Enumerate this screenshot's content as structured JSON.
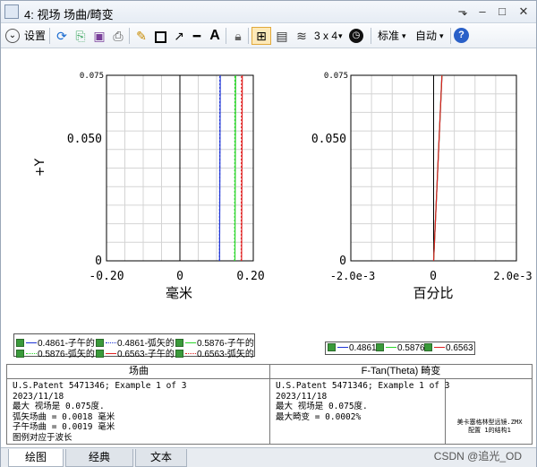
{
  "window": {
    "title": "4: 视场 场曲/畸变"
  },
  "toolbar": {
    "settings_label": "设置",
    "layout_label": "3 x 4",
    "standard_label": "标准",
    "auto_label": "自动"
  },
  "left_chart": {
    "ylabel": "+Y",
    "xlabel": "毫米",
    "yticks": [
      "0.075",
      "0.050",
      "0"
    ],
    "xticks": [
      "-0.20",
      "0",
      "0.20"
    ]
  },
  "right_chart": {
    "xlabel": "百分比",
    "yticks": [
      "0.075",
      "0.050",
      "0"
    ],
    "xticks": [
      "-2.0e-3",
      "0",
      "2.0e-3"
    ]
  },
  "chart_data": [
    {
      "type": "line",
      "ylabel": "+Y",
      "xlabel": "毫米",
      "xlim": [
        -0.2,
        0.2
      ],
      "ylim": [
        0,
        0.075
      ],
      "grid": true,
      "legend": "bottom-left",
      "series": [
        {
          "name": "0.4861-子午的",
          "color": "#1f35d6",
          "style": "solid",
          "x": [
            0.108,
            0.11
          ],
          "y": [
            0,
            0.075
          ]
        },
        {
          "name": "0.4861-弧矢的",
          "color": "#1f35d6",
          "style": "dotted",
          "x": [
            0.108,
            0.109
          ],
          "y": [
            0,
            0.075
          ]
        },
        {
          "name": "0.5876-子午的",
          "color": "#2bd62b",
          "style": "solid",
          "x": [
            0.15,
            0.152
          ],
          "y": [
            0,
            0.075
          ]
        },
        {
          "name": "0.5876-弧矢的",
          "color": "#2bd62b",
          "style": "dotted",
          "x": [
            0.149,
            0.15
          ],
          "y": [
            0,
            0.075
          ]
        },
        {
          "name": "0.6563-子午的",
          "color": "#e02020",
          "style": "solid",
          "x": [
            0.168,
            0.17
          ],
          "y": [
            0,
            0.075
          ]
        },
        {
          "name": "0.6563-弧矢的",
          "color": "#e02020",
          "style": "dotted",
          "x": [
            0.167,
            0.168
          ],
          "y": [
            0,
            0.075
          ]
        }
      ]
    },
    {
      "type": "line",
      "xlabel": "百分比",
      "xlim": [
        -0.002,
        0.002
      ],
      "ylim": [
        0,
        0.075
      ],
      "grid": true,
      "legend": "bottom-right",
      "series": [
        {
          "name": "0.4861",
          "color": "#1f35d6",
          "x": [
            0,
            0.0002
          ],
          "y": [
            0,
            0.075
          ]
        },
        {
          "name": "0.5876",
          "color": "#2bd62b",
          "x": [
            0,
            0.0002
          ],
          "y": [
            0,
            0.075
          ]
        },
        {
          "name": "0.6563",
          "color": "#e02020",
          "x": [
            0,
            0.0002
          ],
          "y": [
            0,
            0.075
          ]
        }
      ]
    }
  ],
  "info": {
    "left_header": "场曲",
    "right_header": "F-Tan(Theta) 畸变",
    "left_text": "U.S.Patent 5471346; Example 1 of 3\n2023/11/18\n最大 视场是 0.075度.\n弧矢场曲 = 0.0018 毫米\n子午场曲 = 0.0019 毫米\n图例对应于波长",
    "right_text": "U.S.Patent 5471346; Example 1 of 3\n2023/11/18\n最大 视场是 0.075度.\n最大畸变 = 0.0002%",
    "file_text": "美卡塞格林型远镜.ZMX\n配置 1的结构1"
  },
  "tabs": [
    "绘图",
    "经典",
    "文本"
  ],
  "watermark": "CSDN @追光_OD"
}
